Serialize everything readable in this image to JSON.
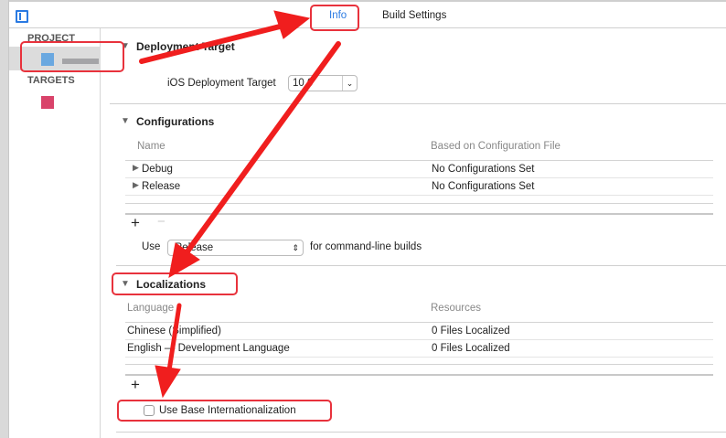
{
  "tabs": {
    "info": "Info",
    "build_settings": "Build Settings"
  },
  "sidebar": {
    "project_header": "PROJECT",
    "targets_header": "TARGETS"
  },
  "deployment": {
    "title": "Deployment Target",
    "label": "iOS Deployment Target",
    "value": "10.0"
  },
  "configurations": {
    "title": "Configurations",
    "col_name": "Name",
    "col_file": "Based on Configuration File",
    "rows": [
      {
        "name": "Debug",
        "file": "No Configurations Set"
      },
      {
        "name": "Release",
        "file": "No Configurations Set"
      }
    ],
    "add": "+",
    "remove": "−",
    "use_label": "Use",
    "use_value": "Release",
    "use_suffix": "for command-line builds"
  },
  "localizations": {
    "title": "Localizations",
    "col_language": "Language",
    "col_resources": "Resources",
    "rows": [
      {
        "language": "Chinese (Simplified)",
        "resources": "0 Files Localized"
      },
      {
        "language": "English — Development Language",
        "resources": "0 Files Localized"
      }
    ],
    "add": "+",
    "base_label": "Use Base Internationalization",
    "base_checked": false
  },
  "annotation_color": "#e8323c"
}
